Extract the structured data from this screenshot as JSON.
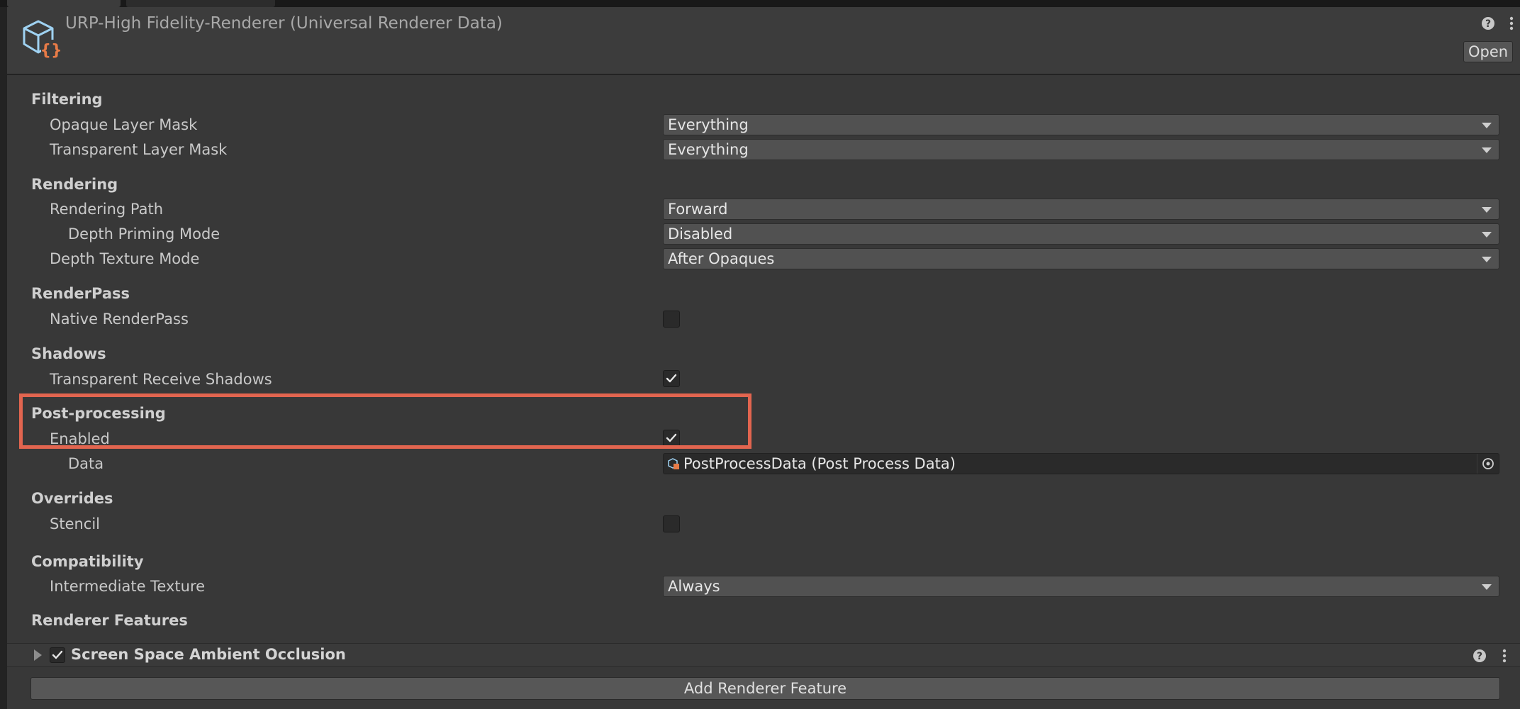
{
  "header": {
    "title": "URP-High Fidelity-Renderer (Universal Renderer Data)",
    "open_label": "Open",
    "icons": [
      "asset-icon",
      "help-icon",
      "more-icon"
    ]
  },
  "sections": {
    "filtering": {
      "title": "Filtering",
      "opaque_label": "Opaque Layer Mask",
      "opaque_value": "Everything",
      "transparent_label": "Transparent Layer Mask",
      "transparent_value": "Everything"
    },
    "rendering": {
      "title": "Rendering",
      "path_label": "Rendering Path",
      "path_value": "Forward",
      "depth_priming_label": "Depth Priming Mode",
      "depth_priming_value": "Disabled",
      "depth_texture_label": "Depth Texture Mode",
      "depth_texture_value": "After Opaques"
    },
    "renderpass": {
      "title": "RenderPass",
      "native_label": "Native RenderPass",
      "native_checked": false
    },
    "shadows": {
      "title": "Shadows",
      "receive_label": "Transparent Receive Shadows",
      "receive_checked": true
    },
    "postprocessing": {
      "title": "Post-processing",
      "enabled_label": "Enabled",
      "enabled_checked": true,
      "data_label": "Data",
      "data_value": "PostProcessData (Post Process Data)"
    },
    "overrides": {
      "title": "Overrides",
      "stencil_label": "Stencil",
      "stencil_checked": false
    },
    "compatibility": {
      "title": "Compatibility",
      "intermediate_label": "Intermediate Texture",
      "intermediate_value": "Always"
    },
    "renderer_features": {
      "title": "Renderer Features",
      "items": [
        {
          "label": "Screen Space Ambient Occlusion",
          "enabled": true
        }
      ],
      "add_label": "Add Renderer Feature"
    }
  },
  "colors": {
    "highlight": "#e2654f",
    "icon_accent": "#e87b47",
    "icon_outline": "#9fd2f2"
  }
}
